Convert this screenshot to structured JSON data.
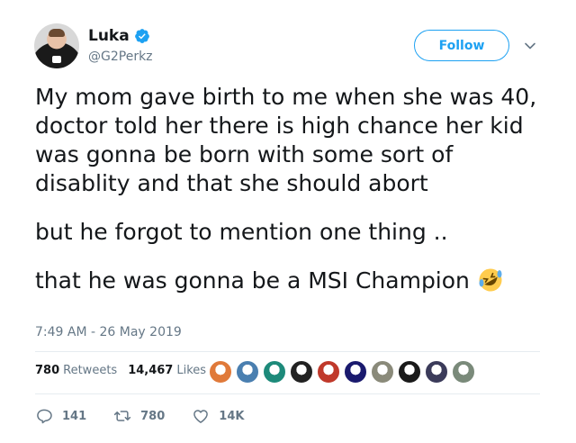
{
  "author": {
    "name": "Luka",
    "handle": "@G2Perkz",
    "verified": true
  },
  "follow_label": "Follow",
  "tweet": {
    "lines_a": [
      "My mom gave birth to me when she was 40,",
      "doctor told her there is high chance her kid",
      "was gonna be born with some sort of",
      "disablity and that she should abort"
    ],
    "line_b": "but he forgot to mention one thing ..",
    "line_c": "that he was gonna be a MSI Champion",
    "emoji": "rolling-on-the-floor-laughing"
  },
  "timestamp": "7:49 AM - 26 May 2019",
  "stats": {
    "retweets_count": "780",
    "retweets_label": "Retweets",
    "likes_count": "14,467",
    "likes_label": "Likes"
  },
  "likers": [
    "#e07a3a",
    "#4a7fb0",
    "#1d8a7a",
    "#222222",
    "#c0392b",
    "#1a1a6e",
    "#8a8a7a",
    "#1a1a1a",
    "#3b3b5a",
    "#7a8a7a"
  ],
  "actions": {
    "reply_count": "141",
    "retweet_count": "780",
    "like_count": "14K"
  },
  "colors": {
    "brand_blue": "#1da1f2",
    "muted": "#657786"
  }
}
